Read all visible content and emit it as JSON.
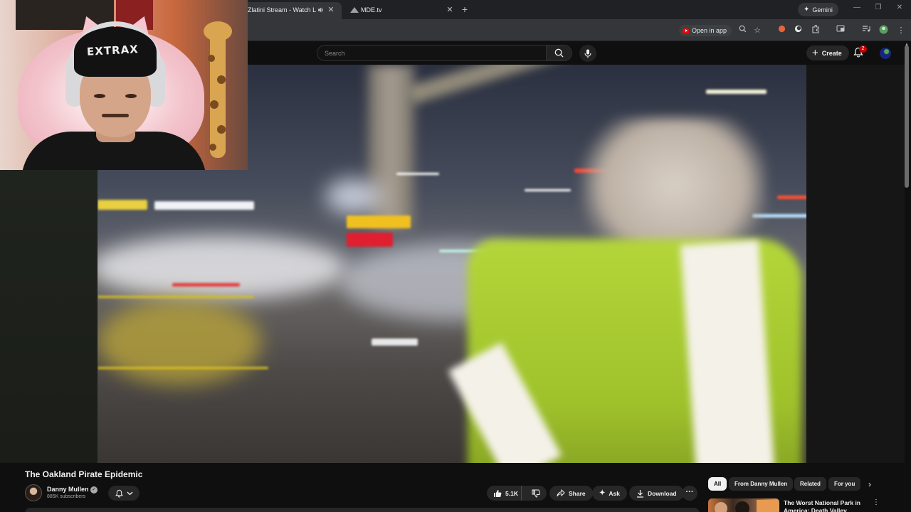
{
  "browser": {
    "tabs": [
      {
        "title": "Zlatini Stream - Watch Live",
        "active": true,
        "audio": true
      },
      {
        "title": "MDE.tv",
        "active": false
      }
    ],
    "gemini_label": "Gemini",
    "open_in_app_label": "Open in app"
  },
  "youtube": {
    "search_placeholder": "Search",
    "create_label": "Create",
    "notifications_count": "2",
    "video": {
      "title": "The Oakland Pirate Epidemic",
      "channel_name": "Danny Mullen",
      "subscribers": "885K subscribers",
      "like_count": "5.1K",
      "share_label": "Share",
      "ask_label": "Ask",
      "download_label": "Download"
    },
    "chips": [
      "All",
      "From Danny Mullen",
      "Related",
      "For you"
    ],
    "recommendation": {
      "title": "The Worst National Park in America: Death Valley"
    }
  },
  "webcam": {
    "beanie_text": "EXTRAX"
  }
}
